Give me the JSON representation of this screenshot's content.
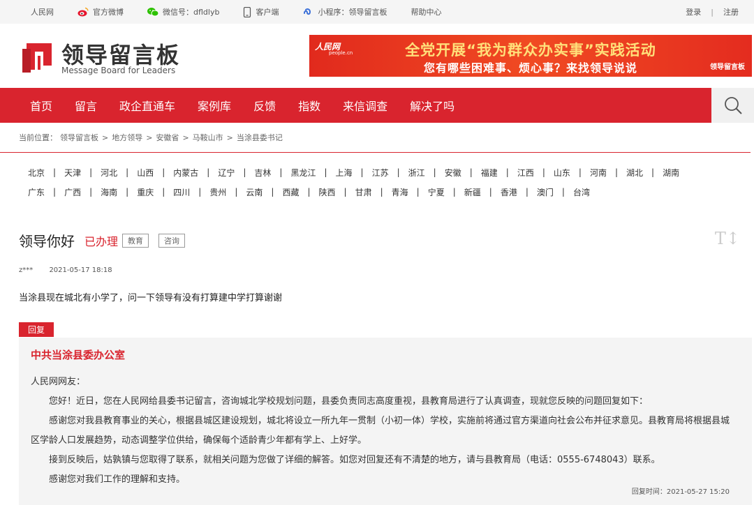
{
  "topbar": {
    "links": [
      {
        "icon": "none",
        "label": "人民网"
      },
      {
        "icon": "weibo-icon",
        "label": "官方微博"
      },
      {
        "icon": "wechat-icon",
        "label": "微信号：dfldlyb"
      },
      {
        "icon": "phone-icon",
        "label": "客户端"
      },
      {
        "icon": "miniprogram-icon",
        "label": "小程序：领导留言板"
      },
      {
        "icon": "none",
        "label": "帮助中心"
      }
    ],
    "login": "登录",
    "separator": "|",
    "register": "注册"
  },
  "header": {
    "logo_cn": "领导留言板",
    "logo_en": "Message Board for Leaders",
    "banner": {
      "brand": "人民网",
      "brand_sub": "people.cn",
      "line1": "全党开展“我为群众办实事”实践活动",
      "line2": "您有哪些困难事、烦心事？来找领导说说",
      "logo": "领导留言板"
    }
  },
  "nav": {
    "items": [
      "首页",
      "留言",
      "政企直通车",
      "案例库",
      "反馈",
      "指数",
      "来信调查",
      "解决了吗"
    ]
  },
  "breadcrumb": {
    "label": "当前位置：",
    "items": [
      "领导留言板",
      "地方领导",
      "安徽省",
      "马鞍山市",
      "当涂县委书记"
    ],
    "separator": ">"
  },
  "regions": {
    "row1": [
      "北京",
      "天津",
      "河北",
      "山西",
      "内蒙古",
      "辽宁",
      "吉林",
      "黑龙江",
      "上海",
      "江苏",
      "浙江",
      "安徽",
      "福建",
      "江西",
      "山东",
      "河南",
      "湖北",
      "湖南"
    ],
    "row2": [
      "广东",
      "广西",
      "海南",
      "重庆",
      "四川",
      "贵州",
      "云南",
      "西藏",
      "陕西",
      "甘肃",
      "青海",
      "宁夏",
      "新疆",
      "香港",
      "澳门",
      "台湾"
    ]
  },
  "question": {
    "title": "领导你好",
    "status": "已办理",
    "tags": [
      "教育",
      "咨询"
    ],
    "user": "z***",
    "time": "2021-05-17 18:18",
    "body": "当涂县现在城北有小学了，问一下领导有没有打算建中学打算谢谢",
    "font_toggle": "T↕"
  },
  "reply": {
    "badge": "回复",
    "org": "中共当涂县委办公室",
    "greeting": "人民网网友：",
    "paragraphs": [
      "您好！近日，您在人民网给县委书记留言，咨询城北学校规划问题，县委负责同志高度重视，县教育局进行了认真调查，现就您反映的问题回复如下：",
      "感谢您对我县教育事业的关心，根据县城区建设规划，城北将设立一所九年一贯制（小初一体）学校，实施前将通过官方渠道向社会公布并征求意见。县教育局将根据县城区学龄人口发展趋势，动态调整学位供给，确保每个适龄青少年都有学上、上好学。",
      "接到反映后，姑孰镇与您取得了联系，就相关问题为您做了详细的解答。如您对回复还有不清楚的地方，请与县教育局（电话：0555-6748043）联系。",
      "感谢您对我们工作的理解和支持。"
    ],
    "time": "回复时间：2021-05-27 15:20"
  },
  "colors": {
    "accent": "#d9242e",
    "topbar_bg": "#f5f5f5",
    "reply_bg": "#f4f4f4"
  }
}
